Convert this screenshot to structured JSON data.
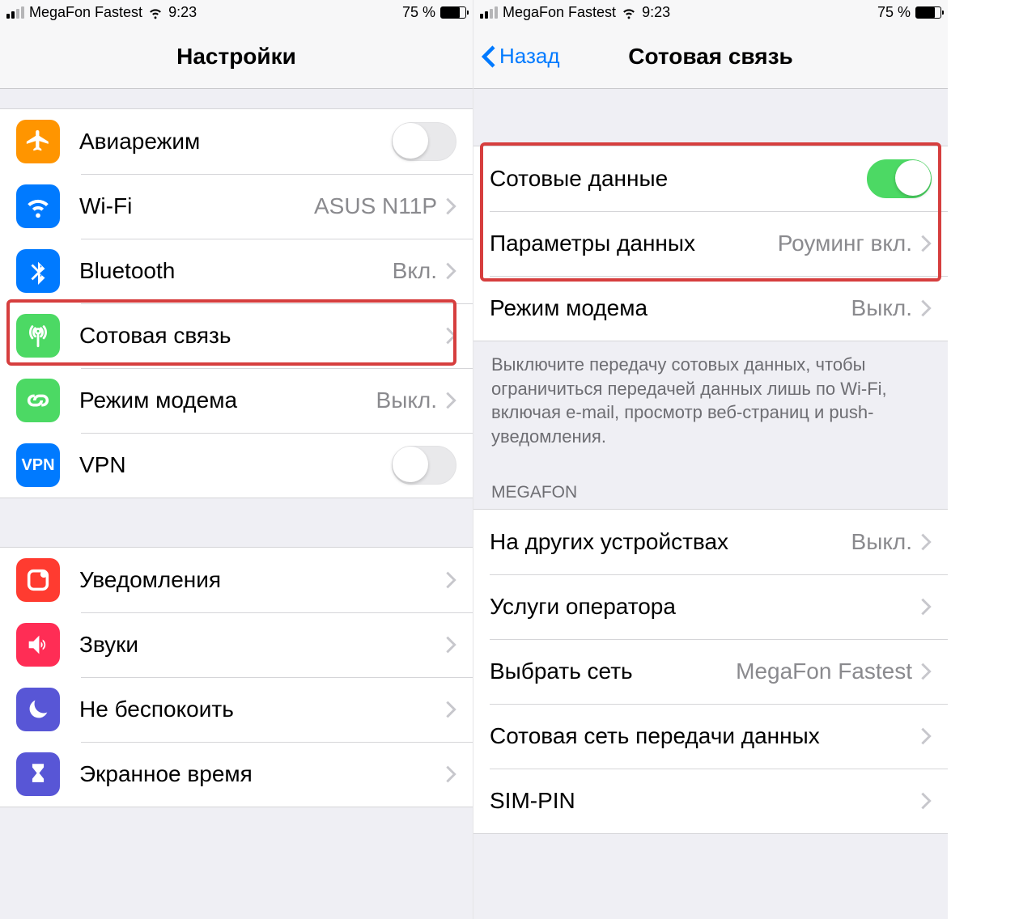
{
  "status": {
    "carrier": "MegaFon Fastest",
    "time": "9:23",
    "battery_pct": "75 %"
  },
  "left": {
    "title": "Настройки",
    "rows": {
      "airplane": "Авиарежим",
      "wifi": "Wi-Fi",
      "wifi_detail": "ASUS N11P",
      "bluetooth": "Bluetooth",
      "bluetooth_detail": "Вкл.",
      "cellular": "Сотовая связь",
      "hotspot": "Режим модема",
      "hotspot_detail": "Выкл.",
      "vpn": "VPN",
      "notifications": "Уведомления",
      "sounds": "Звуки",
      "dnd": "Не беспокоить",
      "screentime": "Экранное время"
    }
  },
  "right": {
    "back": "Назад",
    "title": "Сотовая связь",
    "rows": {
      "cell_data": "Сотовые данные",
      "data_options": "Параметры данных",
      "data_options_detail": "Роуминг вкл.",
      "hotspot": "Режим модема",
      "hotspot_detail": "Выкл.",
      "other_devices": "На других устройствах",
      "other_devices_detail": "Выкл.",
      "carrier_services": "Услуги оператора",
      "select_network": "Выбрать сеть",
      "select_network_detail": "MegaFon Fastest",
      "cell_data_network": "Сотовая сеть передачи данных",
      "sim_pin": "SIM-PIN"
    },
    "footer": "Выключите передачу сотовых данных, чтобы ограничиться передачей данных лишь по Wi-Fi, включая e-mail, просмотр веб-страниц и push-уведомления.",
    "section_carrier": "MEGAFON"
  }
}
